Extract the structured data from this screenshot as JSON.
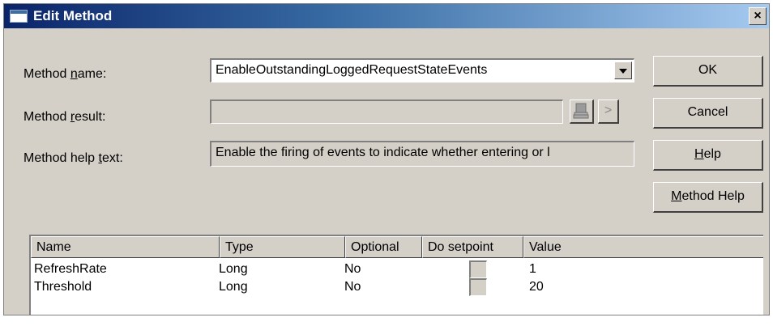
{
  "window": {
    "title": "Edit Method",
    "close_glyph": "×"
  },
  "labels": {
    "method_name": [
      "Method ",
      "n",
      "ame:"
    ],
    "method_result": [
      "Method ",
      "r",
      "esult:"
    ],
    "method_help_text": [
      "Method help ",
      "t",
      "ext:"
    ]
  },
  "fields": {
    "method_name_value": "EnableOutstandingLoggedRequestStateEvents",
    "method_result_value": "",
    "method_help_value": "Enable the firing of events to indicate whether entering or l"
  },
  "result_next_glyph": ">",
  "buttons": {
    "ok": "OK",
    "cancel": "Cancel",
    "help": [
      "",
      "H",
      "elp"
    ],
    "method_help": [
      "",
      "M",
      "ethod Help"
    ]
  },
  "table": {
    "columns": [
      "Name",
      "Type",
      "Optional",
      "Do setpoint",
      "Value"
    ],
    "rows": [
      {
        "name": "RefreshRate",
        "type": "Long",
        "optional": "No",
        "value": "1"
      },
      {
        "name": "Threshold",
        "type": "Long",
        "optional": "No",
        "value": "20"
      }
    ]
  }
}
